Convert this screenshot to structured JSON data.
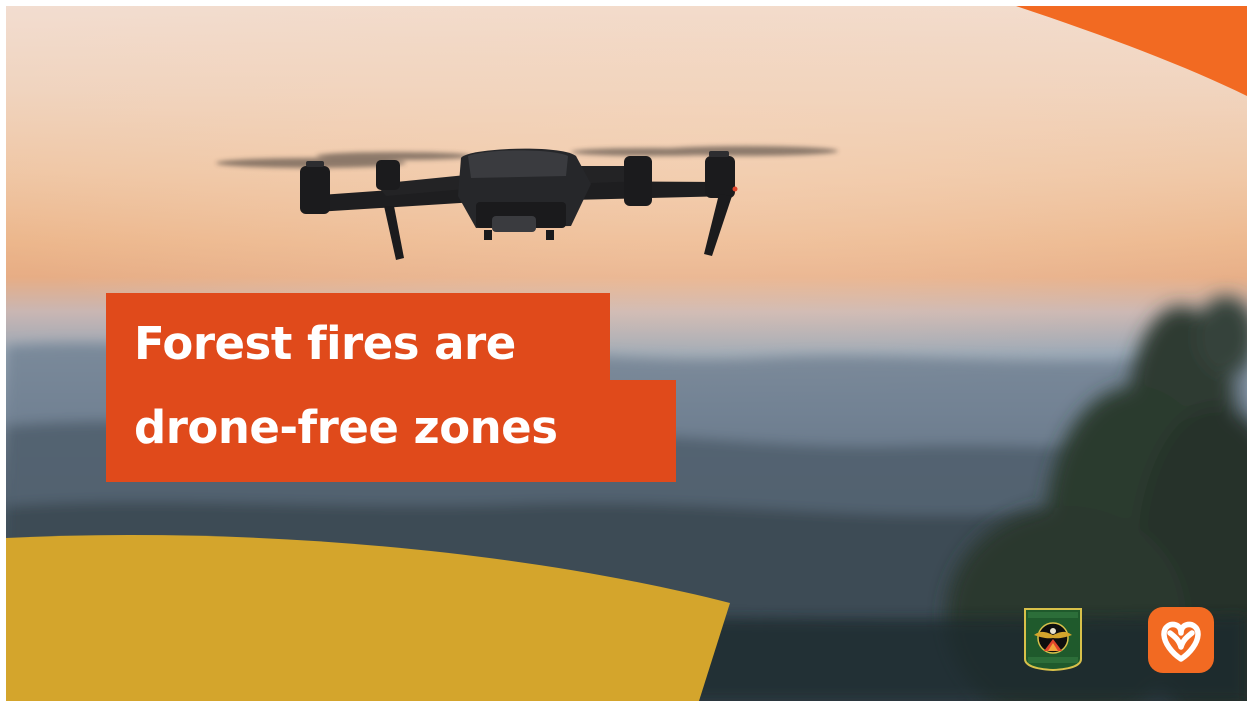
{
  "headline": {
    "line1": "Forest fires are",
    "line2": "drone-free zones"
  },
  "colors": {
    "headline_bg": "#e04a1b",
    "headline_text": "#ffffff",
    "accent_orange": "#f26a22",
    "accent_gold": "#d4a52c",
    "ontario_logo": "#f26a22"
  },
  "icons": {
    "drone": "drone-icon",
    "mnr_badge": "ministry-badge-icon",
    "ontario_logo": "ontario-trillium-icon"
  }
}
